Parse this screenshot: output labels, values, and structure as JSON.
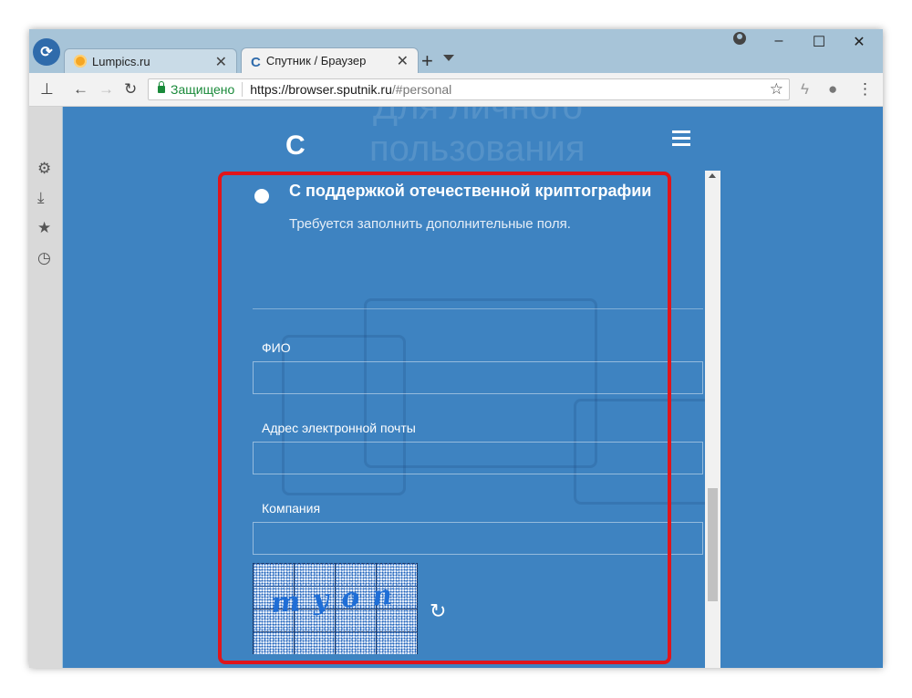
{
  "browser": {
    "tabs": [
      {
        "title": "Lumpics.ru",
        "active": false,
        "favicon": "orange-circle-icon"
      },
      {
        "title": "Спутник / Браузер",
        "active": true,
        "favicon": "sputnik-logo-icon"
      }
    ],
    "new_tab_symbol": "+",
    "window_controls": {
      "minimize": "–",
      "maximize": "☐",
      "close": "✕"
    },
    "address_bar": {
      "secure_label": "Защищено",
      "url_main": "https://browser.sputnik.ru",
      "url_rest": "/#personal"
    }
  },
  "page": {
    "background_color": "#3e83c1",
    "ghost_texts": [
      "Для личного",
      "пользования"
    ],
    "option": {
      "title": "С поддержкой отечественной криптографии",
      "description": "Требуется заполнить дополнительные поля."
    },
    "fields": [
      {
        "label": "ФИО",
        "value": ""
      },
      {
        "label": "Адрес электронной почты",
        "value": ""
      },
      {
        "label": "Компания",
        "value": ""
      }
    ],
    "captcha": {
      "text": "myon"
    }
  },
  "highlight_color": "#e0151b"
}
